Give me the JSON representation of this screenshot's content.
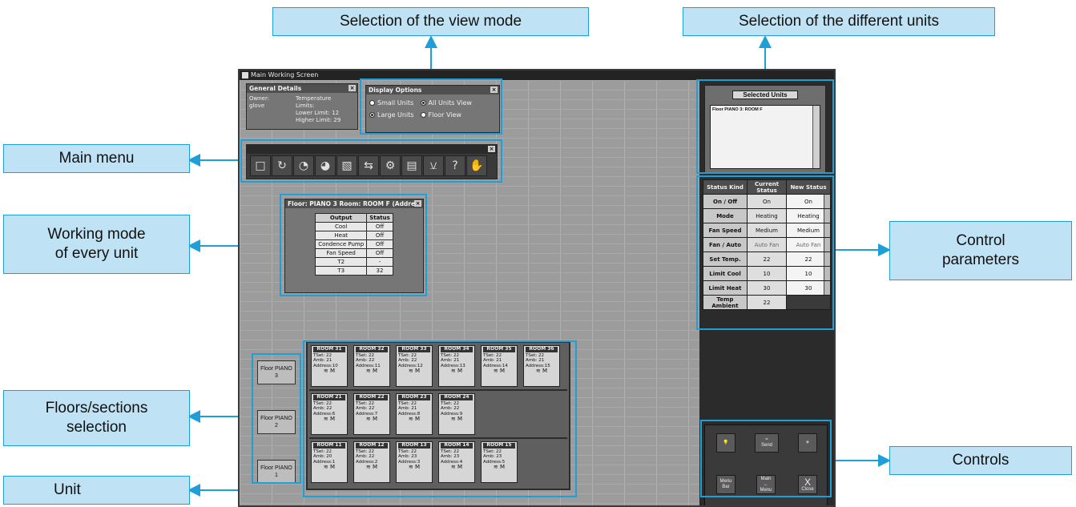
{
  "callouts": {
    "view_mode": "Selection of the view mode",
    "units": "Selection of the different units",
    "main_menu": "Main menu",
    "working_mode_1": "Working mode",
    "working_mode_2": "of every unit",
    "control_1": "Control",
    "control_2": "parameters",
    "floors_1": "Floors/sections",
    "floors_2": "selection",
    "unit": "Unit",
    "controls": "Controls"
  },
  "window": {
    "title": "Main Working Screen"
  },
  "general_details": {
    "title": "General Details",
    "owner_label": "Owner:",
    "owner_value": "glove",
    "temp_label": "Temperature",
    "limits_label": "Limits:",
    "lower_limit": "Lower Limit: 12",
    "higher_limit": "Higher Limit: 29"
  },
  "display_options": {
    "title": "Display Options",
    "small_units": "Small Units",
    "large_units": "Large Units",
    "all_units_view": "All Units View",
    "floor_view": "Floor View"
  },
  "unit_popup": {
    "title": "Floor: PIANO 3 Room: ROOM F (Addre",
    "headers": [
      "Output",
      "Status"
    ],
    "rows": [
      [
        "Cool",
        "Off"
      ],
      [
        "Heat",
        "Off"
      ],
      [
        "Condence Pump",
        "Off"
      ],
      [
        "Fan Speed",
        "Off"
      ],
      [
        "T2",
        "-"
      ],
      [
        "T3",
        "32"
      ]
    ]
  },
  "floors": [
    {
      "line1": "Floor PIANO",
      "line2": "3"
    },
    {
      "line1": "Floor PIANO",
      "line2": "2"
    },
    {
      "line1": "Floor PIANO",
      "line2": "1"
    }
  ],
  "units": {
    "row1": [
      {
        "name": "ROOM 31",
        "tset": "22",
        "amb": "21",
        "addr": "10"
      },
      {
        "name": "ROOM 32",
        "tset": "22",
        "amb": "22",
        "addr": "11"
      },
      {
        "name": "ROOM 33",
        "tset": "22",
        "amb": "22",
        "addr": "12"
      },
      {
        "name": "ROOM 34",
        "tset": "22",
        "amb": "21",
        "addr": "13"
      },
      {
        "name": "ROOM 35",
        "tset": "22",
        "amb": "21",
        "addr": "14"
      },
      {
        "name": "ROOM 36",
        "tset": "22",
        "amb": "21",
        "addr": "15"
      }
    ],
    "row2": [
      {
        "name": "ROOM 21",
        "tset": "22",
        "amb": "22",
        "addr": "6"
      },
      {
        "name": "ROOM 22",
        "tset": "22",
        "amb": "22",
        "addr": "7"
      },
      {
        "name": "ROOM 23",
        "tset": "22",
        "amb": "21",
        "addr": "8"
      },
      {
        "name": "ROOM 24",
        "tset": "22",
        "amb": "22",
        "addr": "9"
      }
    ],
    "row3": [
      {
        "name": "ROOM 11",
        "tset": "22",
        "amb": "20",
        "addr": "1"
      },
      {
        "name": "ROOM 12",
        "tset": "22",
        "amb": "22",
        "addr": "2"
      },
      {
        "name": "ROOM 13",
        "tset": "22",
        "amb": "23",
        "addr": "3"
      },
      {
        "name": "ROOM 14",
        "tset": "22",
        "amb": "23",
        "addr": "4"
      },
      {
        "name": "ROOM 15",
        "tset": "22",
        "amb": "23",
        "addr": "5"
      }
    ],
    "labels": {
      "tset": "TSet:",
      "amb": "Amb:",
      "addr": "Address:"
    }
  },
  "selected_units": {
    "title": "Selected Units",
    "item": "Floor PIANO 3:   ROOM F"
  },
  "control_params": {
    "headers": [
      "Status Kind",
      "Current Status",
      "New Status"
    ],
    "rows": [
      {
        "kind": "On / Off",
        "current": "On",
        "new": "On"
      },
      {
        "kind": "Mode",
        "current": "Heating",
        "new": "Heating"
      },
      {
        "kind": "Fan Speed",
        "current": "Medium",
        "new": "Medium"
      },
      {
        "kind": "Fan / Auto",
        "current": "Auto Fan",
        "new": "Auto Fan"
      },
      {
        "kind": "Set Temp.",
        "current": "22",
        "new": "22"
      },
      {
        "kind": "Limit Cool",
        "current": "10",
        "new": "10"
      },
      {
        "kind": "Limit Heat",
        "current": "30",
        "new": "30"
      },
      {
        "kind": "Temp Ambient",
        "current": "22",
        "new": ""
      }
    ]
  },
  "controls": {
    "send": "Send",
    "menu_bar_1": "Menu",
    "menu_bar_2": "Bar",
    "main_menu_1": "Main",
    "main_menu_2": "Menu",
    "close_x": "X",
    "close": "Close"
  },
  "colors": {
    "accent": "#1e9fd8",
    "callout_bg": "#bfe3f5"
  }
}
